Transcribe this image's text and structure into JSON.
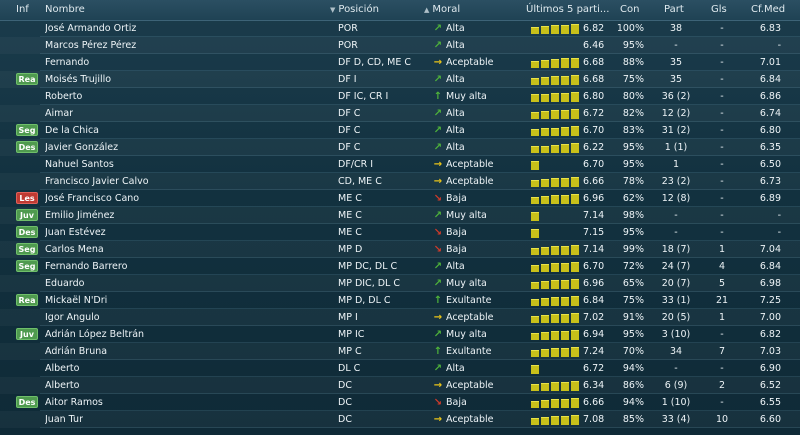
{
  "header": {
    "inf": "Inf",
    "nombre": "Nombre",
    "posicion": "Posición",
    "moral": "Moral",
    "ultimos": "Últimos 5 parti...",
    "con": "Con",
    "part": "Part",
    "gls": "Gls",
    "cfmed": "Cf.Med"
  },
  "colors": {
    "moral_up": "#4fb43a",
    "moral_neutral": "#e6c21a",
    "moral_down": "#d23a2a",
    "form_bar": "#c8c01a",
    "badge_green": "#4f9a4f",
    "badge_red": "#c03a32"
  },
  "players": [
    {
      "inf": "",
      "nombre": "José Armando Ortiz",
      "posicion": "POR",
      "moral_icon": "↗",
      "moral_trend": "up",
      "moral": "Alta",
      "form": [
        0.7,
        0.8,
        0.9,
        0.9,
        1.0
      ],
      "forma_valor": "6.82",
      "con": "100%",
      "part": "38",
      "gls": "-",
      "cfmed": "6.83"
    },
    {
      "inf": "",
      "nombre": "Marcos Pérez Pérez",
      "posicion": "POR",
      "moral_icon": "↗",
      "moral_trend": "up",
      "moral": "Alta",
      "form": [],
      "forma_valor": "6.46",
      "con": "95%",
      "part": "-",
      "gls": "-",
      "cfmed": "-"
    },
    {
      "inf": "",
      "nombre": "Fernando",
      "posicion": "DF D, CD, ME C",
      "moral_icon": "→",
      "moral_trend": "neutral",
      "moral": "Aceptable",
      "form": [
        0.7,
        0.8,
        0.9,
        1.0,
        1.0
      ],
      "forma_valor": "6.68",
      "con": "88%",
      "part": "35",
      "gls": "-",
      "cfmed": "7.01"
    },
    {
      "inf": "Rea",
      "inf_color": "green",
      "nombre": "Moisés Trujillo",
      "posicion": "DF I",
      "moral_icon": "↗",
      "moral_trend": "up",
      "moral": "Alta",
      "form": [
        0.7,
        0.8,
        0.9,
        0.9,
        1.0
      ],
      "forma_valor": "6.68",
      "con": "75%",
      "part": "35",
      "gls": "-",
      "cfmed": "6.84"
    },
    {
      "inf": "",
      "nombre": "Roberto",
      "posicion": "DF IC, CR I",
      "moral_icon": "↑",
      "moral_trend": "up",
      "moral": "Muy alta",
      "form": [
        0.8,
        0.8,
        0.9,
        0.9,
        1.0
      ],
      "forma_valor": "6.80",
      "con": "80%",
      "part": "36 (2)",
      "gls": "-",
      "cfmed": "6.86"
    },
    {
      "inf": "",
      "nombre": "Aimar",
      "posicion": "DF C",
      "moral_icon": "↗",
      "moral_trend": "up",
      "moral": "Alta",
      "form": [
        0.7,
        0.8,
        0.9,
        0.9,
        1.0
      ],
      "forma_valor": "6.72",
      "con": "82%",
      "part": "12 (2)",
      "gls": "-",
      "cfmed": "6.74"
    },
    {
      "inf": "Seg",
      "inf_color": "green",
      "nombre": "De la Chica",
      "posicion": "DF C",
      "moral_icon": "↗",
      "moral_trend": "up",
      "moral": "Alta",
      "form": [
        0.7,
        0.8,
        0.8,
        0.9,
        1.0
      ],
      "forma_valor": "6.70",
      "con": "83%",
      "part": "31 (2)",
      "gls": "-",
      "cfmed": "6.80"
    },
    {
      "inf": "Des",
      "inf_color": "green",
      "nombre": "Javier González",
      "posicion": "DF C",
      "moral_icon": "↗",
      "moral_trend": "up",
      "moral": "Alta",
      "form": [
        0.7,
        0.7,
        0.8,
        0.9,
        1.0
      ],
      "forma_valor": "6.22",
      "con": "95%",
      "part": "1 (1)",
      "gls": "-",
      "cfmed": "6.35"
    },
    {
      "inf": "",
      "nombre": "Nahuel Santos",
      "posicion": "DF/CR I",
      "moral_icon": "→",
      "moral_trend": "neutral",
      "moral": "Aceptable",
      "form": [
        0.9
      ],
      "forma_valor": "6.70",
      "con": "95%",
      "part": "1",
      "gls": "-",
      "cfmed": "6.50"
    },
    {
      "inf": "",
      "nombre": "Francisco Javier Calvo",
      "posicion": "CD, ME C",
      "moral_icon": "→",
      "moral_trend": "neutral",
      "moral": "Aceptable",
      "form": [
        0.7,
        0.8,
        0.9,
        0.9,
        1.0
      ],
      "forma_valor": "6.66",
      "con": "78%",
      "part": "23 (2)",
      "gls": "-",
      "cfmed": "6.73"
    },
    {
      "inf": "Les",
      "inf_color": "red",
      "nombre": "José Francisco Cano",
      "posicion": "ME C",
      "moral_icon": "↘",
      "moral_trend": "down",
      "moral": "Baja",
      "form": [
        0.7,
        0.8,
        0.9,
        0.9,
        1.0
      ],
      "forma_valor": "6.96",
      "con": "62%",
      "part": "12 (8)",
      "gls": "-",
      "cfmed": "6.89"
    },
    {
      "inf": "Juv",
      "inf_color": "green",
      "nombre": "Emilio Jiménez",
      "posicion": "ME C",
      "moral_icon": "↗",
      "moral_trend": "up",
      "moral": "Muy alta",
      "form": [
        0.9
      ],
      "forma_valor": "7.14",
      "con": "98%",
      "part": "-",
      "gls": "-",
      "cfmed": "-"
    },
    {
      "inf": "Des",
      "inf_color": "green",
      "nombre": "Juan Estévez",
      "posicion": "ME C",
      "moral_icon": "↘",
      "moral_trend": "down",
      "moral": "Baja",
      "form": [
        0.9
      ],
      "forma_valor": "7.15",
      "con": "95%",
      "part": "-",
      "gls": "-",
      "cfmed": "-"
    },
    {
      "inf": "Seg",
      "inf_color": "green",
      "nombre": "Carlos Mena",
      "posicion": "MP D",
      "moral_icon": "↘",
      "moral_trend": "down",
      "moral": "Baja",
      "form": [
        0.7,
        0.8,
        0.9,
        0.9,
        1.0
      ],
      "forma_valor": "7.14",
      "con": "99%",
      "part": "18 (7)",
      "gls": "1",
      "cfmed": "7.04"
    },
    {
      "inf": "Seg",
      "inf_color": "green",
      "nombre": "Fernando Barrero",
      "posicion": "MP DC, DL C",
      "moral_icon": "↗",
      "moral_trend": "up",
      "moral": "Alta",
      "form": [
        0.7,
        0.8,
        0.9,
        0.9,
        1.0
      ],
      "forma_valor": "6.70",
      "con": "72%",
      "part": "24 (7)",
      "gls": "4",
      "cfmed": "6.84"
    },
    {
      "inf": "",
      "nombre": "Eduardo",
      "posicion": "MP DIC, DL C",
      "moral_icon": "↗",
      "moral_trend": "up",
      "moral": "Muy alta",
      "form": [
        0.7,
        0.8,
        0.9,
        0.9,
        1.0
      ],
      "forma_valor": "6.96",
      "con": "65%",
      "part": "20 (7)",
      "gls": "5",
      "cfmed": "6.98"
    },
    {
      "inf": "Rea",
      "inf_color": "green",
      "nombre": "Mickaël N'Dri",
      "posicion": "MP D, DL C",
      "moral_icon": "↑",
      "moral_trend": "up",
      "moral": "Exultante",
      "form": [
        0.7,
        0.8,
        0.9,
        0.9,
        1.0
      ],
      "forma_valor": "6.84",
      "con": "75%",
      "part": "33 (1)",
      "gls": "21",
      "cfmed": "7.25"
    },
    {
      "inf": "",
      "nombre": "Igor Angulo",
      "posicion": "MP I",
      "moral_icon": "→",
      "moral_trend": "neutral",
      "moral": "Aceptable",
      "form": [
        0.7,
        0.8,
        0.9,
        0.9,
        1.0
      ],
      "forma_valor": "7.02",
      "con": "91%",
      "part": "20 (5)",
      "gls": "1",
      "cfmed": "7.00"
    },
    {
      "inf": "Juv",
      "inf_color": "green",
      "nombre": "Adrián López Beltrán",
      "posicion": "MP IC",
      "moral_icon": "↗",
      "moral_trend": "up",
      "moral": "Muy alta",
      "form": [
        0.7,
        0.8,
        0.9,
        0.9,
        1.0
      ],
      "forma_valor": "6.94",
      "con": "95%",
      "part": "3 (10)",
      "gls": "-",
      "cfmed": "6.82"
    },
    {
      "inf": "",
      "nombre": "Adrián Bruna",
      "posicion": "MP C",
      "moral_icon": "↑",
      "moral_trend": "up",
      "moral": "Exultante",
      "form": [
        0.7,
        0.8,
        0.9,
        0.9,
        1.0
      ],
      "forma_valor": "7.24",
      "con": "70%",
      "part": "34",
      "gls": "7",
      "cfmed": "7.03"
    },
    {
      "inf": "",
      "nombre": "Alberto",
      "posicion": "DL C",
      "moral_icon": "↗",
      "moral_trend": "up",
      "moral": "Alta",
      "form": [
        0.9
      ],
      "forma_valor": "6.72",
      "con": "94%",
      "part": "-",
      "gls": "-",
      "cfmed": "6.90"
    },
    {
      "inf": "",
      "nombre": "Alberto",
      "posicion": "DC",
      "moral_icon": "→",
      "moral_trend": "neutral",
      "moral": "Aceptable",
      "form": [
        0.7,
        0.8,
        0.9,
        0.9,
        1.0
      ],
      "forma_valor": "6.34",
      "con": "86%",
      "part": "6 (9)",
      "gls": "2",
      "cfmed": "6.52"
    },
    {
      "inf": "Des",
      "inf_color": "green",
      "nombre": "Aitor Ramos",
      "posicion": "DC",
      "moral_icon": "↘",
      "moral_trend": "down",
      "moral": "Baja",
      "form": [
        0.7,
        0.8,
        0.9,
        0.9,
        1.0
      ],
      "forma_valor": "6.66",
      "con": "94%",
      "part": "1 (10)",
      "gls": "-",
      "cfmed": "6.55"
    },
    {
      "inf": "",
      "nombre": "Juan Tur",
      "posicion": "DC",
      "moral_icon": "→",
      "moral_trend": "neutral",
      "moral": "Aceptable",
      "form": [
        0.7,
        0.8,
        0.9,
        0.9,
        1.0
      ],
      "forma_valor": "7.08",
      "con": "85%",
      "part": "33 (4)",
      "gls": "10",
      "cfmed": "6.60"
    }
  ]
}
